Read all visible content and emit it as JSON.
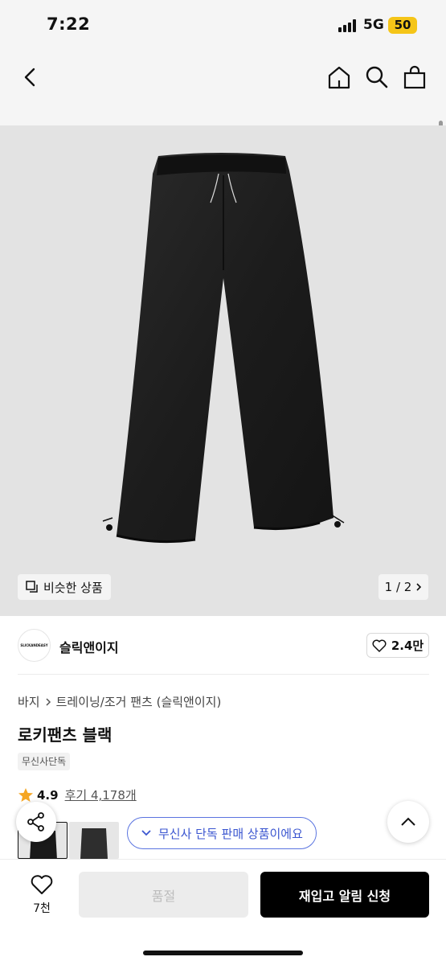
{
  "status_bar": {
    "time": "7:22",
    "network": "5G",
    "battery": "50"
  },
  "product": {
    "similar_label": "비슷한 상품",
    "page_indicator": "1 / 2",
    "brand_logo_text": "SLICKANDEASY",
    "brand_name": "슬릭앤이지",
    "likes": "2.4만",
    "breadcrumb": [
      "바지",
      "트레이닝/조거 팬츠 (슬릭앤이지)"
    ],
    "title": "로키팬츠 블랙",
    "tag": "무신사단독",
    "rating": "4.9",
    "reviews": "후기 4,178개",
    "exclusive_notice": "무신사 단독 판매 상품이에요"
  },
  "bottom_bar": {
    "wish_count": "7천",
    "soldout_label": "품절",
    "restock_label": "재입고 알림 신청"
  },
  "colors": {
    "accent_blue": "#3b56d0",
    "star": "#f5a623",
    "battery": "#f5c518"
  }
}
